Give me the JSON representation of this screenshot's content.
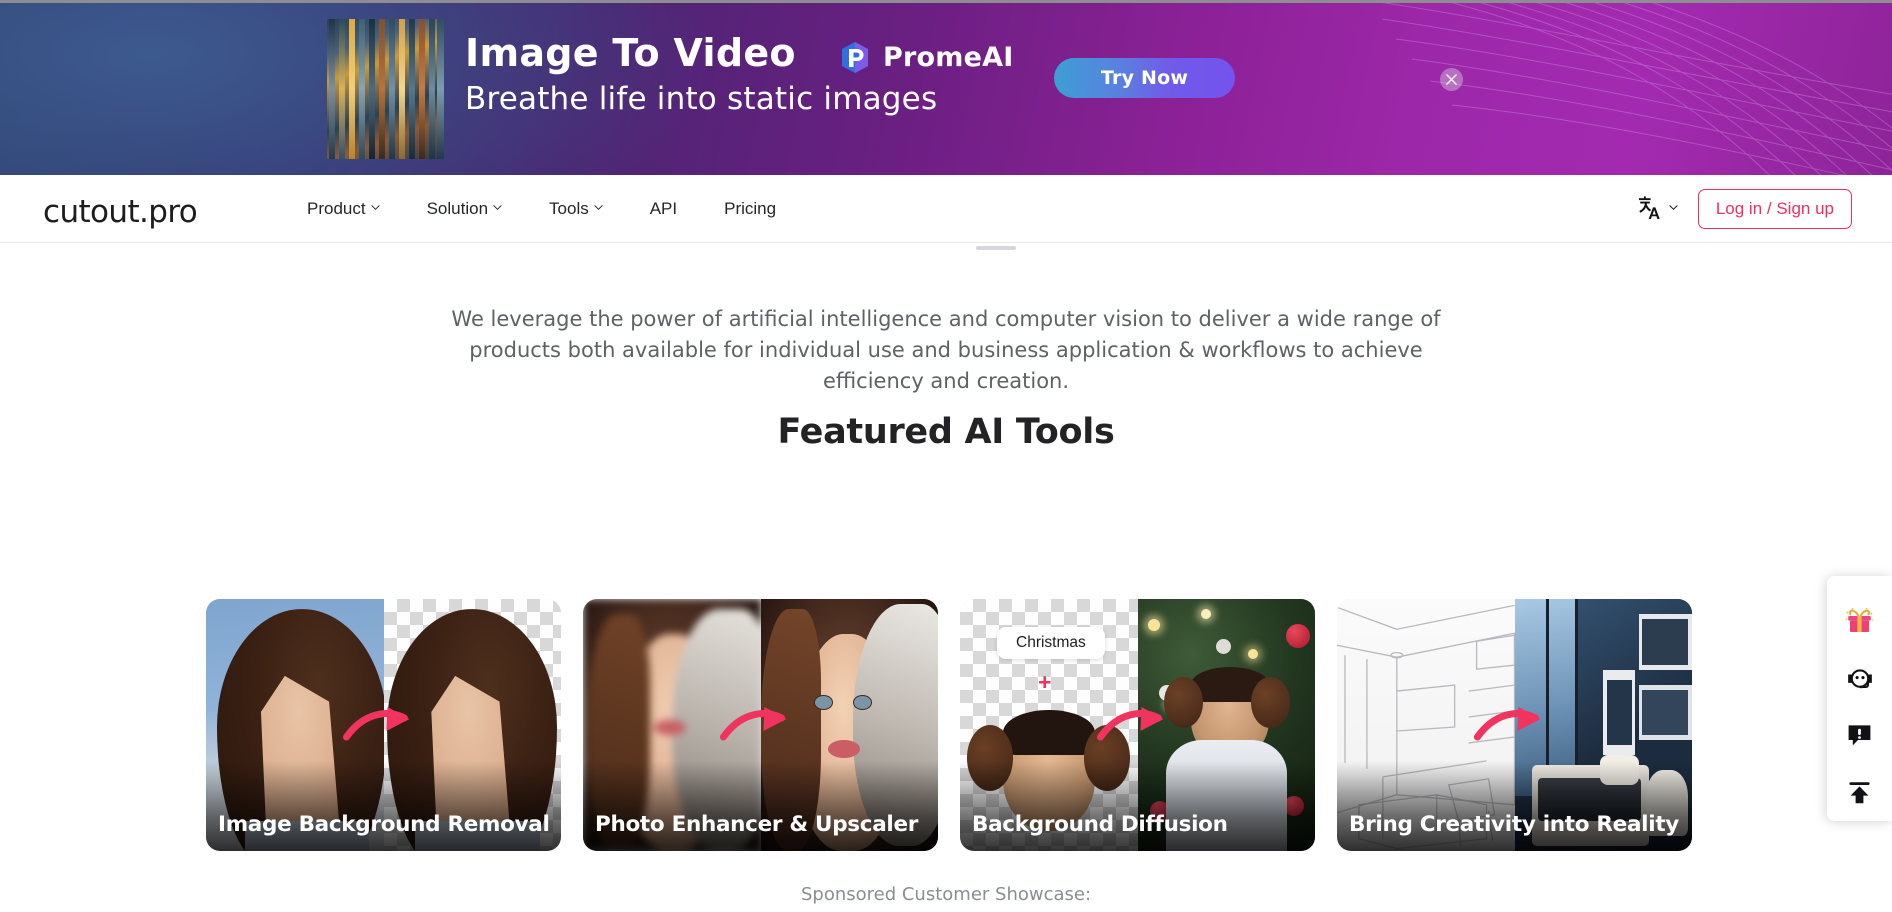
{
  "ad_banner": {
    "headline": "Image To Video",
    "subline": "Breathe life into static images",
    "brand": "PromeAI",
    "cta_label": "Try Now",
    "close_label": "×",
    "colors": {
      "gradient_start": "#2b3f6b",
      "gradient_end": "#a32ab0",
      "cta_gradient_start": "#3c9fd4",
      "cta_gradient_end": "#7452ee"
    }
  },
  "navbar": {
    "brand": "cutout.pro",
    "links": [
      {
        "label": "Product",
        "has_dropdown": true
      },
      {
        "label": "Solution",
        "has_dropdown": true
      },
      {
        "label": "Tools",
        "has_dropdown": true
      },
      {
        "label": "API",
        "has_dropdown": false
      },
      {
        "label": "Pricing",
        "has_dropdown": false
      }
    ],
    "language_icon": "translate-icon",
    "auth_label": "Log in / Sign up",
    "accent_color": "#f02e5d"
  },
  "main": {
    "intro_paragraph": "We leverage the power of artificial intelligence and computer vision to deliver a wide range of products both available for individual use and business application & workflows to achieve efficiency and creation.",
    "section_title": "Featured AI Tools",
    "sponsored_text": "Sponsored Customer Showcase:",
    "cards": [
      {
        "label": "Image Background Removal",
        "before": "portrait-blue-background",
        "after": "portrait-transparent-background"
      },
      {
        "label": "Photo Enhancer & Upscaler",
        "before": "blurry-portrait",
        "after": "sharp-portrait"
      },
      {
        "label": "Background Diffusion",
        "before": "cutout-child-transparent",
        "after": "child-christmas-tree",
        "chip": "Christmas",
        "plus": "+"
      },
      {
        "label": "Bring Creativity into Reality",
        "before": "bedroom-line-sketch",
        "after": "bedroom-rendered-photo"
      }
    ]
  },
  "side_widget": {
    "items": [
      {
        "icon": "gift-icon",
        "name": "rewards"
      },
      {
        "icon": "customer-service-icon",
        "name": "support"
      },
      {
        "icon": "feedback-icon",
        "name": "feedback"
      },
      {
        "icon": "back-to-top-icon",
        "name": "scroll-top"
      }
    ]
  }
}
